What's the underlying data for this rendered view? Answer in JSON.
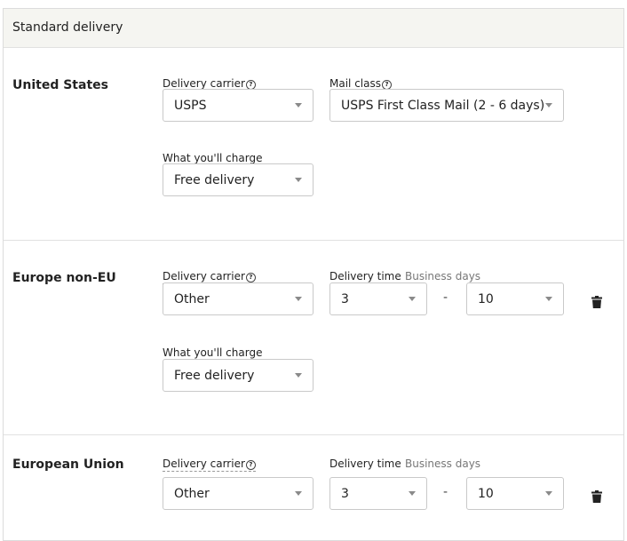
{
  "header": {
    "title": "Standard delivery"
  },
  "sections": [
    {
      "region": "United States",
      "carrier": {
        "label": "Delivery carrier",
        "help": "?",
        "value": "USPS"
      },
      "mail_class": {
        "label": "Mail class",
        "help": "?",
        "value": "USPS First Class Mail (2 - 6 days)"
      },
      "charge": {
        "label": "What you'll charge",
        "value": "Free delivery"
      }
    },
    {
      "region": "Europe non-EU",
      "carrier": {
        "label": "Delivery carrier",
        "help": "?",
        "value": "Other"
      },
      "delivery_time": {
        "label": "Delivery time",
        "sublabel": "Business days",
        "min": "3",
        "separator": "-",
        "max": "10"
      },
      "charge": {
        "label": "What you'll charge",
        "value": "Free delivery"
      },
      "delete_icon": "trash-icon"
    },
    {
      "region": "European Union",
      "carrier": {
        "label": "Delivery carrier",
        "help": "?",
        "value": "Other"
      },
      "delivery_time": {
        "label": "Delivery time",
        "sublabel": "Business days",
        "min": "3",
        "separator": "-",
        "max": "10"
      },
      "delete_icon": "trash-icon"
    }
  ]
}
